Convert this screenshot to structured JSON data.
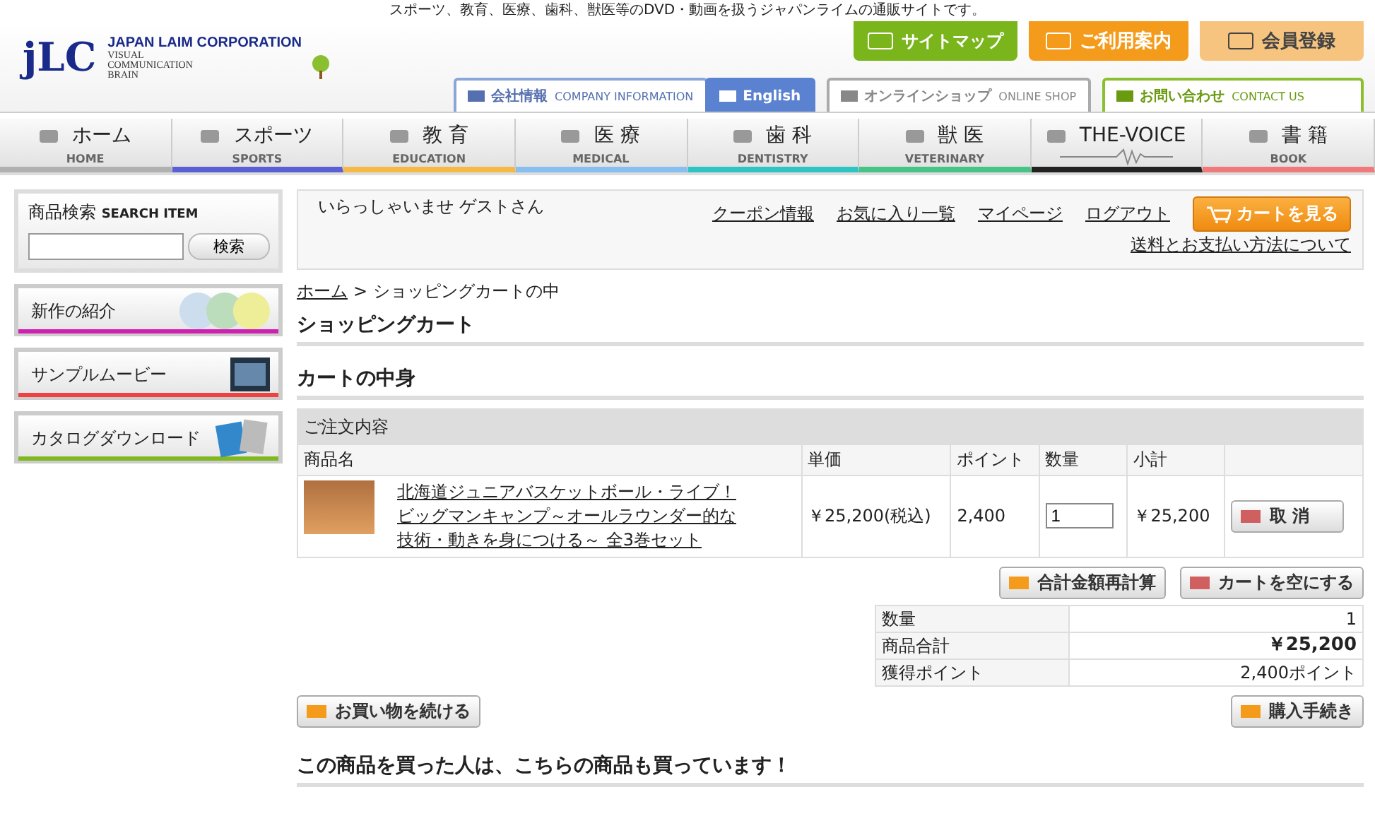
{
  "tagline": "スポーツ、教育、医療、歯科、獣医等のDVD・動画を扱うジャパンライムの通販サイトです。",
  "logo": {
    "mark": "jLC",
    "name": "JAPAN LAIM CORPORATION",
    "sub": [
      "VISUAL",
      "COMMUNICATION",
      "BRAIN"
    ]
  },
  "header_buttons": [
    {
      "label": "サイトマップ",
      "kind": "green"
    },
    {
      "label": "ご利用案内",
      "kind": "orange"
    },
    {
      "label": "会員登録",
      "kind": "light"
    }
  ],
  "header_tabs": [
    {
      "label": "会社情報",
      "en": "COMPANY INFORMATION",
      "kind": "blue"
    },
    {
      "label": "English",
      "kind": "blue-fill"
    },
    {
      "label": "オンラインショップ",
      "en": "ONLINE SHOP",
      "kind": "grey"
    },
    {
      "label": "お問い合わせ",
      "en": "CONTACT US",
      "kind": "green"
    }
  ],
  "nav": [
    {
      "label": "ホーム",
      "en": "HOME",
      "color": "#b0b0b0"
    },
    {
      "label": "スポーツ",
      "en": "SPORTS",
      "color": "#5a5fd6"
    },
    {
      "label": "教 育",
      "en": "EDUCATION",
      "color": "#f5b945"
    },
    {
      "label": "医 療",
      "en": "MEDICAL",
      "color": "#86bff0"
    },
    {
      "label": "歯 科",
      "en": "DENTISTRY",
      "color": "#2ec4c4"
    },
    {
      "label": "獣 医",
      "en": "VETERINARY",
      "color": "#45c486"
    },
    {
      "label": "THE-VOICE",
      "color": "#222222"
    },
    {
      "label": "書 籍",
      "en": "BOOK",
      "color": "#f07a7a"
    }
  ],
  "search": {
    "title": "商品検索",
    "en": "SEARCH ITEM",
    "button": "検索"
  },
  "banners": [
    {
      "label": "新作の紹介",
      "color": "#d020b0",
      "kind": "discs"
    },
    {
      "label": "サンプルムービー",
      "color": "#f04040",
      "kind": "film"
    },
    {
      "label": "カタログダウンロード",
      "color": "#80b820",
      "kind": "catalog"
    }
  ],
  "welcome": "いらっしゃいませ ゲストさん",
  "links": [
    "クーポン情報",
    "お気に入り一覧",
    "マイページ",
    "ログアウト"
  ],
  "cart_button": "カートを見る",
  "payment_link": "送料とお支払い方法について",
  "breadcrumb": {
    "home": "ホーム",
    "sep": ">",
    "current": "ショッピングカートの中"
  },
  "title": "ショッピングカート",
  "section": "カートの中身",
  "order": {
    "caption": "ご注文内容",
    "columns": [
      "商品名",
      "単価",
      "ポイント",
      "数量",
      "小計"
    ],
    "rows": [
      {
        "name": "北海道ジュニアバスケットボール・ライブ！ビッグマンキャンプ～オールラウンダー的な技術・動きを身につける～ 全3巻セット",
        "price": "￥25,200(税込)",
        "points": "2,400",
        "qty": "1",
        "subtotal": "￥25,200",
        "remove": "取 消"
      }
    ]
  },
  "recalc": "合計金額再計算",
  "empty": "カートを空にする",
  "summary": [
    {
      "label": "数量",
      "value": "1",
      "bold": false
    },
    {
      "label": "商品合計",
      "value": "￥25,200",
      "bold": true
    },
    {
      "label": "獲得ポイント",
      "value": "2,400ポイント",
      "bold": false
    }
  ],
  "continue": "お買い物を続ける",
  "checkout": "購入手続き",
  "related": "この商品を買った人は、こちらの商品も買っています！"
}
